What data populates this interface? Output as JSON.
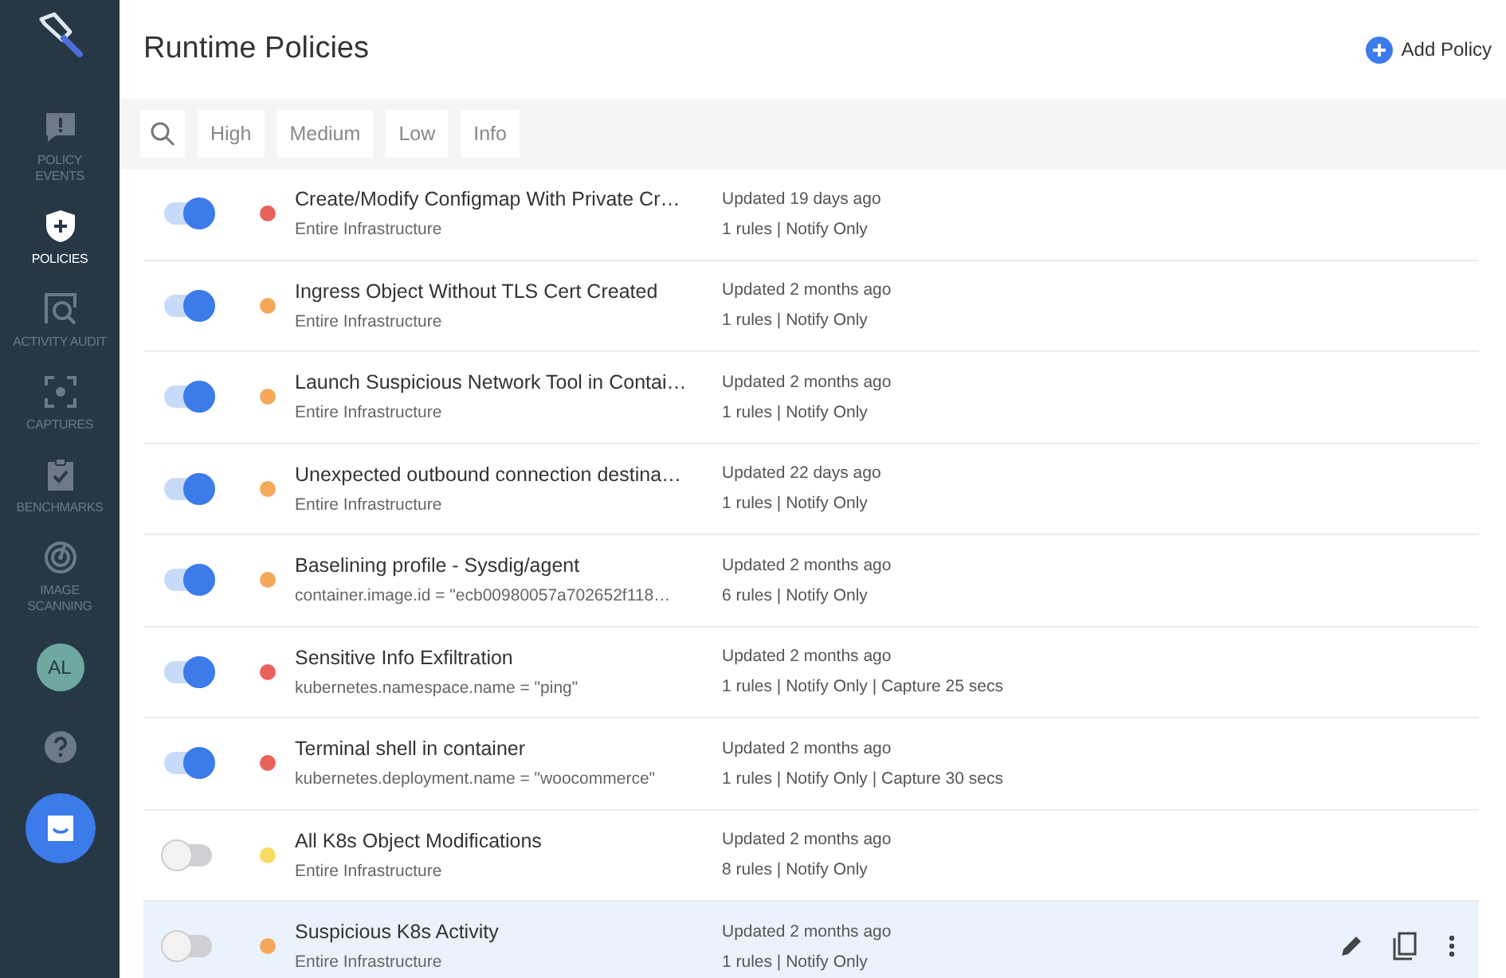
{
  "sidebar": {
    "items": [
      {
        "label": "POLICY EVENTS",
        "selected": false
      },
      {
        "label": "POLICIES",
        "selected": true
      },
      {
        "label": "ACTIVITY AUDIT",
        "selected": false
      },
      {
        "label": "CAPTURES",
        "selected": false
      },
      {
        "label": "BENCHMARKS",
        "selected": false
      },
      {
        "label": "IMAGE SCANNING",
        "selected": false
      }
    ],
    "avatar": "AL"
  },
  "header": {
    "title": "Runtime Policies",
    "add_button": "Add Policy"
  },
  "filters": [
    {
      "label": "High",
      "selected": false
    },
    {
      "label": "Medium",
      "selected": false
    },
    {
      "label": "Low",
      "selected": false
    },
    {
      "label": "Info",
      "selected": false
    }
  ],
  "policies": [
    {
      "on": true,
      "color": "#e8615b",
      "title": "Create/Modify Configmap With Private Cr…",
      "scope": "Entire Infrastructure",
      "updated": "Updated 19 days ago",
      "summary": "1 rules | Notify Only",
      "selected": false
    },
    {
      "on": true,
      "color": "#f4a95a",
      "title": "Ingress Object Without TLS Cert Created",
      "scope": "Entire Infrastructure",
      "updated": "Updated 2 months ago",
      "summary": "1 rules | Notify Only",
      "selected": false
    },
    {
      "on": true,
      "color": "#f4a95a",
      "title": "Launch Suspicious Network Tool in Contai…",
      "scope": "Entire Infrastructure",
      "updated": "Updated 2 months ago",
      "summary": "1 rules | Notify Only",
      "selected": false
    },
    {
      "on": true,
      "color": "#f4a95a",
      "title": "Unexpected outbound connection destina…",
      "scope": "Entire Infrastructure",
      "updated": "Updated 22 days ago",
      "summary": "1 rules | Notify Only",
      "selected": false
    },
    {
      "on": true,
      "color": "#f4a95a",
      "title": "Baselining profile - Sysdig/agent",
      "scope": "container.image.id = \"ecb00980057a702652f118…",
      "updated": "Updated 2 months ago",
      "summary": "6 rules | Notify Only",
      "selected": false
    },
    {
      "on": true,
      "color": "#e8615b",
      "title": "Sensitive Info Exfiltration",
      "scope": "kubernetes.namespace.name = \"ping\"",
      "updated": "Updated 2 months ago",
      "summary": "1 rules | Notify Only | Capture 25 secs",
      "selected": false
    },
    {
      "on": true,
      "color": "#e8615b",
      "title": "Terminal shell in container",
      "scope": "kubernetes.deployment.name = \"woocommerce\"",
      "updated": "Updated 2 months ago",
      "summary": "1 rules | Notify Only | Capture 30 secs",
      "selected": false
    },
    {
      "on": false,
      "color": "#f7dc62",
      "title": "All K8s Object Modifications",
      "scope": "Entire Infrastructure",
      "updated": "Updated 2 months ago",
      "summary": "8 rules | Notify Only",
      "selected": false
    },
    {
      "on": false,
      "color": "#f4a95a",
      "title": "Suspicious K8s Activity",
      "scope": "Entire Infrastructure",
      "updated": "Updated 2 months ago",
      "summary": "1 rules | Notify Only",
      "selected": true
    }
  ]
}
